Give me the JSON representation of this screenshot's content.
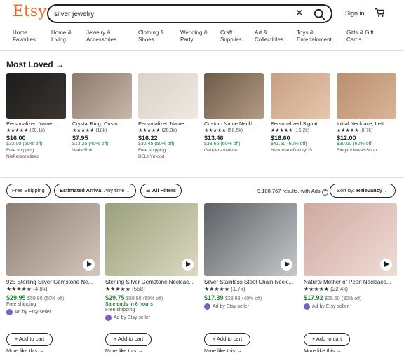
{
  "header": {
    "logo": "Etsy",
    "search_value": "silver jewelry",
    "signin": "Sign in",
    "cart_icon": "cart-icon"
  },
  "nav": [
    [
      "Home",
      "Favorites"
    ],
    [
      "Home &",
      "Living"
    ],
    [
      "Jewelry &",
      "Accessories"
    ],
    [
      "Clothing &",
      "Shoes"
    ],
    [
      "Wedding &",
      "Party"
    ],
    [
      "Craft",
      "Supplies"
    ],
    [
      "Art &",
      "Collectibles"
    ],
    [
      "Toys &",
      "Entertainment"
    ],
    [
      "Gifts & Gift",
      "Cards"
    ]
  ],
  "most_loved": {
    "title": "Most Loved",
    "arrow": "→",
    "items": [
      {
        "title": "Personalized Name ...",
        "stars": "★★★★★",
        "count": "(20.1k)",
        "price": "$16.00",
        "orig": "$32.00 (50% off)",
        "ship": "Free shipping",
        "shop": "NisPersonalized"
      },
      {
        "title": "Crystal Ring, Custo...",
        "stars": "★★★★★",
        "count": "(18k)",
        "price": "$7.95",
        "orig": "$13.25 (40% off)",
        "ship": "",
        "shop": "WaterRok"
      },
      {
        "title": "Personalized Name ...",
        "stars": "★★★★★",
        "count": "(28.3k)",
        "price": "$16.22",
        "orig": "$32.45 (50% off)",
        "ship": "Free shipping",
        "shop": "BELKYmood"
      },
      {
        "title": "Custom Name Neckl...",
        "stars": "★★★★★",
        "count": "(58.5k)",
        "price": "$13.46",
        "orig": "$33.65 (60% off)",
        "ship": "",
        "shop": "Geopersonalized"
      },
      {
        "title": "Personalized Signat...",
        "stars": "★★★★★",
        "count": "(16.2k)",
        "price": "$16.60",
        "orig": "$41.50 (60% off)",
        "ship": "",
        "shop": "HandmadeDaintyUS"
      },
      {
        "title": "Initial Necklace, Lett...",
        "stars": "★★★★★",
        "count": "(8.7k)",
        "price": "$12.00",
        "orig": "$30.00 (60% off)",
        "ship": "",
        "shop": "ElegantJewelsShop"
      }
    ]
  },
  "filters": {
    "free_shipping": "Free Shipping",
    "arrival_label": "Estimated Arrival",
    "arrival_value": "Any time",
    "all_filters": "All Filters",
    "results": "9,108,767 results, with Ads",
    "sort_label": "Sort by:",
    "sort_value": "Relevancy"
  },
  "listings": [
    {
      "title": "925 Sterling Silver Gemstone Ne...",
      "stars": "★★★★★",
      "count": "(4.8k)",
      "price": "$29.95",
      "old": "$59.90",
      "off": "(50% off)",
      "sale": "",
      "ship": "Free shipping",
      "ad": "Ad by Etsy seller",
      "cart": "Add to cart",
      "more": "More like this"
    },
    {
      "title": "Sterling Silver Gemstone Necklac...",
      "stars": "★★★★★",
      "count": "(558)",
      "price": "$29.75",
      "old": "$59.50",
      "off": "(50% off)",
      "sale": "Sale ends in 6 hours",
      "ship": "Free shipping",
      "ad": "Ad by Etsy seller",
      "cart": "Add to cart",
      "more": "More like this"
    },
    {
      "title": "Silver Stainless Steel Chain Neckl...",
      "stars": "★★★★★",
      "count": "(1.7k)",
      "price": "$17.39",
      "old": "$28.99",
      "off": "(40% off)",
      "sale": "",
      "ship": "",
      "ad": "Ad by Etsy seller",
      "cart": "Add to cart",
      "more": "More like this"
    },
    {
      "title": "Natural Mother of Pearl Necklace...",
      "stars": "★★★★★",
      "count": "(22.4k)",
      "price": "$17.92",
      "old": "$25.60",
      "off": "(30% off)",
      "sale": "",
      "ship": "",
      "ad": "Ad by Etsy seller",
      "cart": "Add to cart",
      "more": "More like this"
    }
  ],
  "colors": {
    "brand": "#f1641e",
    "sale": "#258635",
    "ad_dot": "#7b5fc6"
  }
}
